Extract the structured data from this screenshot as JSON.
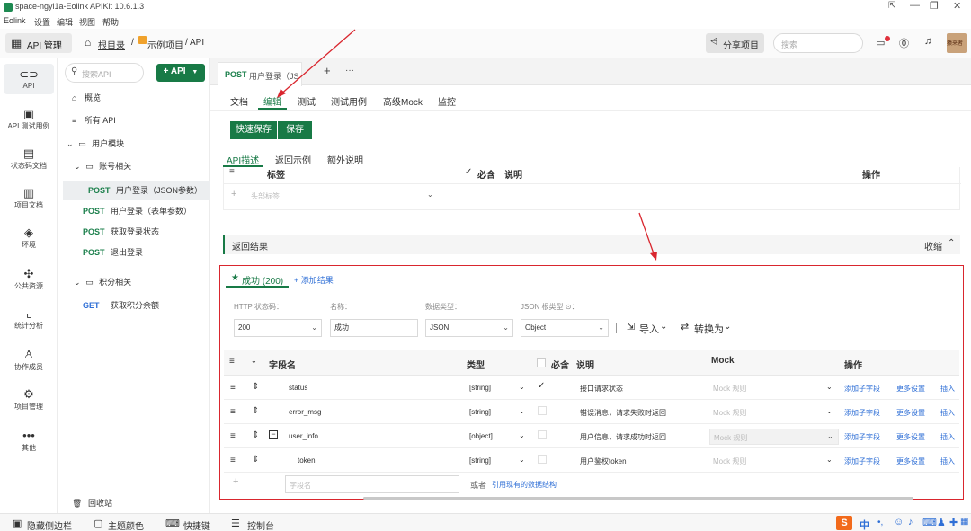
{
  "window": {
    "title": "space-ngyi1a-Eolink APIKit 10.6.1.3"
  },
  "menu": [
    "Eolink",
    "设置",
    "编辑",
    "视图",
    "帮助"
  ],
  "topbar": {
    "api_manage": "API 管理",
    "breadcrumb": [
      "根目录",
      "/",
      "示例项目",
      "/ API"
    ],
    "share": "分享项目",
    "search_placeholder": "搜索",
    "avatar_text": "猿来者"
  },
  "sidenav": [
    {
      "icon": "link-icon",
      "label": "API"
    },
    {
      "icon": "clipboard-icon",
      "label": "API 测试用例"
    },
    {
      "icon": "code-doc-icon",
      "label": "状态码文档"
    },
    {
      "icon": "doc-icon",
      "label": "项目文档"
    },
    {
      "icon": "env-icon",
      "label": "环境"
    },
    {
      "icon": "puzzle-icon",
      "label": "公共资源"
    },
    {
      "icon": "chart-icon",
      "label": "统计分析"
    },
    {
      "icon": "users-icon",
      "label": "协作成员"
    },
    {
      "icon": "gear-icon",
      "label": "项目管理"
    },
    {
      "icon": "more-icon",
      "label": "其他"
    }
  ],
  "tree": {
    "search_placeholder": "搜索API",
    "add_api": "+ API",
    "overview": "概览",
    "all_api": "所有 API",
    "group_user": "用户模块",
    "group_account": "账号相关",
    "apis": [
      {
        "method": "POST",
        "name": "用户登录（JSON参数）"
      },
      {
        "method": "POST",
        "name": "用户登录（表单参数）"
      },
      {
        "method": "POST",
        "name": "获取登录状态"
      },
      {
        "method": "POST",
        "name": "退出登录"
      }
    ],
    "group_points": "积分相关",
    "points_api": {
      "method": "GET",
      "name": "获取积分余额"
    },
    "recycle": "回收站"
  },
  "tab": {
    "method": "POST",
    "title": "用户登录（JS",
    "plus": "+",
    "more": "···"
  },
  "subtabs": [
    "文档",
    "编辑",
    "测试",
    "测试用例",
    "高级Mock",
    "监控"
  ],
  "buttons": {
    "quick_save": "快速保存",
    "save": "保存"
  },
  "desc_tabs": [
    "API描述",
    "返回示例",
    "额外说明"
  ],
  "header_table": {
    "cols": {
      "tag": "标签",
      "required": "必含",
      "desc": "说明",
      "ops": "操作"
    },
    "placeholder": "头部标签"
  },
  "result_section": {
    "title": "返回结果",
    "collapse": "收缩"
  },
  "response": {
    "tab": "成功 (200)",
    "add": "+ 添加结果",
    "labels": {
      "status": "HTTP 状态码：",
      "name": "名称：",
      "type": "数据类型：",
      "root": "JSON 根类型 ⊙："
    },
    "values": {
      "status": "200",
      "name": "成功",
      "type": "JSON",
      "root": "Object"
    },
    "import": "导入",
    "convert": "转换为"
  },
  "fields_table": {
    "headers": {
      "name": "字段名",
      "type": "类型",
      "required": "必含",
      "desc": "说明",
      "mock": "Mock",
      "ops": "操作"
    },
    "rows": [
      {
        "name": "status",
        "type": "[string]",
        "required": true,
        "desc": "接口请求状态",
        "mock": "Mock 规则"
      },
      {
        "name": "error_msg",
        "type": "[string]",
        "required": false,
        "desc": "错误消息，请求失败时返回",
        "mock": "Mock 规则"
      },
      {
        "name": "user_info",
        "type": "[object]",
        "required": false,
        "desc": "用户信息，请求成功时返回",
        "mock": "Mock 规则"
      },
      {
        "name": "token",
        "type": "[string]",
        "required": false,
        "desc": "用户鉴权token",
        "mock": "Mock 规则"
      }
    ],
    "row_ops": {
      "add_child": "添加子字段",
      "more": "更多设置",
      "insert": "插入"
    },
    "new_field_placeholder": "字段名",
    "or_text": "或者",
    "ref_link": "引用现有的数据结构"
  },
  "statusbar": {
    "hide": "隐藏侧边栏",
    "theme": "主题颜色",
    "shortcut": "快捷键",
    "console": "控制台",
    "ime": "中"
  },
  "colors": {
    "accent": "#187a46",
    "annotation": "#d9262e",
    "link": "#2f6fd6"
  }
}
